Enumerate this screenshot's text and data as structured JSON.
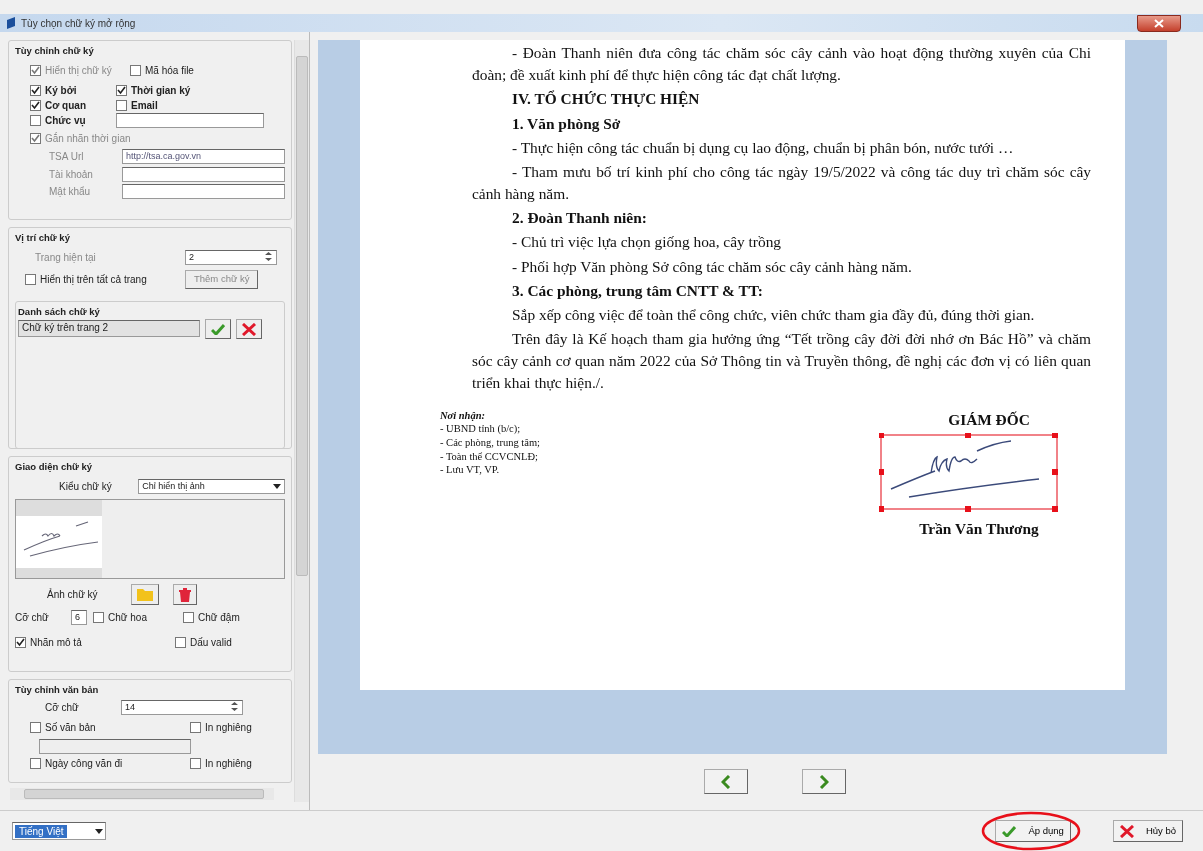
{
  "window": {
    "title": "Tùy chọn chữ ký mở rộng"
  },
  "signature_content": {
    "title": "Tùy chỉnh chữ ký",
    "options": [
      {
        "label": "Hiển thị chữ ký",
        "checked": true,
        "disabled": true,
        "bold": false
      },
      {
        "label": "Mã hóa file",
        "checked": false,
        "disabled": false,
        "bold": false
      },
      {
        "label": "Ký bởi",
        "checked": true,
        "disabled": false,
        "bold": true
      },
      {
        "label": "Thời gian ký",
        "checked": true,
        "disabled": false,
        "bold": true
      },
      {
        "label": "Cơ quan",
        "checked": true,
        "disabled": false,
        "bold": true
      },
      {
        "label": "Email",
        "checked": false,
        "disabled": false,
        "bold": true
      },
      {
        "label": "Chức vụ",
        "checked": false,
        "disabled": false,
        "bold": true
      }
    ],
    "timestamp": {
      "label": "Gắn nhãn thời gian",
      "checked": true
    },
    "fields": [
      {
        "label": "TSA Url",
        "value": "http://tsa.ca.gov.vn"
      },
      {
        "label": "Tài khoản"
      },
      {
        "label": "Mật khẩu"
      }
    ]
  },
  "position": {
    "title": "Vị trí chữ ký",
    "current_page_label": "Trang hiện tại",
    "current_page": "2",
    "all_pages": {
      "label": "Hiển thị trên tất cả trang",
      "checked": false
    },
    "add_button": {
      "label": "Thêm chữ ký",
      "disabled": true
    },
    "list": {
      "title": "Danh sách chữ ký",
      "items": [
        {
          "label": "Chữ ký trên trang 2",
          "selected": true
        }
      ]
    }
  },
  "appearance": {
    "title": "Giao diện chữ ký",
    "style_label": "Kiểu chữ ký",
    "style": "Chỉ hiển thị ảnh",
    "image_label": "Ảnh chữ ký",
    "font_size_label": "Cỡ chữ",
    "font_size": "6",
    "options": [
      {
        "label": "Chữ hoa",
        "checked": false
      },
      {
        "label": "Chữ đậm",
        "checked": false
      },
      {
        "label": "Nhãn mô tả",
        "checked": true
      },
      {
        "label": "Dấu valid",
        "checked": false
      }
    ]
  },
  "text_settings": {
    "title": "Tùy chỉnh văn bản",
    "font_size_label": "Cỡ chữ",
    "font_size": "14",
    "options": [
      {
        "label": "Số văn bản",
        "checked": false
      },
      {
        "label": "In nghiêng",
        "checked": false
      },
      {
        "label": "Ngày công văn đi",
        "checked": false
      },
      {
        "label": "In nghiêng",
        "checked": false
      }
    ]
  },
  "language": "Tiếng Việt",
  "document": {
    "paragraphs": [
      {
        "kind": "para",
        "text": "- Đoàn Thanh niên đưa công tác chăm sóc cây cảnh vào hoạt động thường xuyên của Chi đoàn; đề xuất kinh phí để thực hiện công tác đạt chất lượng."
      },
      {
        "kind": "heading",
        "text": "IV. TỔ CHỨC THỰC HIỆN"
      },
      {
        "kind": "heading",
        "text": "1. Văn phòng Sở"
      },
      {
        "kind": "para",
        "text": "- Thực hiện công tác chuẩn bị dụng cụ lao động, chuẩn bị phân bón, nước tưới …"
      },
      {
        "kind": "para",
        "text": "- Tham mưu bố trí kinh phí cho công tác ngày 19/5/2022 và công tác duy trì chăm sóc cây cảnh hàng năm."
      },
      {
        "kind": "heading",
        "text": "2. Đoàn Thanh niên:"
      },
      {
        "kind": "para",
        "text": "- Chủ trì việc lựa chọn giống hoa, cây trồng"
      },
      {
        "kind": "para",
        "text": "- Phối hợp Văn phòng Sở công tác chăm sóc cây cảnh hàng năm."
      },
      {
        "kind": "heading",
        "text": "3. Các phòng, trung tâm CNTT & TT:"
      },
      {
        "kind": "para",
        "text": "Sắp xếp công việc để toàn thể công chức, viên chức tham gia đầy đủ, đúng thời gian."
      },
      {
        "kind": "para",
        "text": "Trên đây là Kế hoạch tham gia hưởng ứng “Tết trồng cây đời đời nhớ ơn Bác Hồ” và chăm sóc cây cảnh cơ quan năm 2022 của Sở Thông tin và Truyền thông, đề nghị các đơn vị có liên quan triển khai thực hiện./."
      }
    ],
    "recipients": {
      "title": "Nơi nhận:",
      "items": [
        "- UBND tỉnh (b/c);",
        "- Các phòng, trung tâm;",
        "- Toàn thể CCVCNLĐ;",
        "- Lưu VT, VP."
      ]
    },
    "signer": {
      "role": "GIÁM ĐỐC",
      "name": "Trần Văn Thương",
      "selected": true
    }
  },
  "buttons": [
    {
      "label": "Áp dụng",
      "kind": "apply",
      "highlighted": true
    },
    {
      "label": "Hủy bỏ",
      "kind": "cancel",
      "highlighted": false
    }
  ]
}
